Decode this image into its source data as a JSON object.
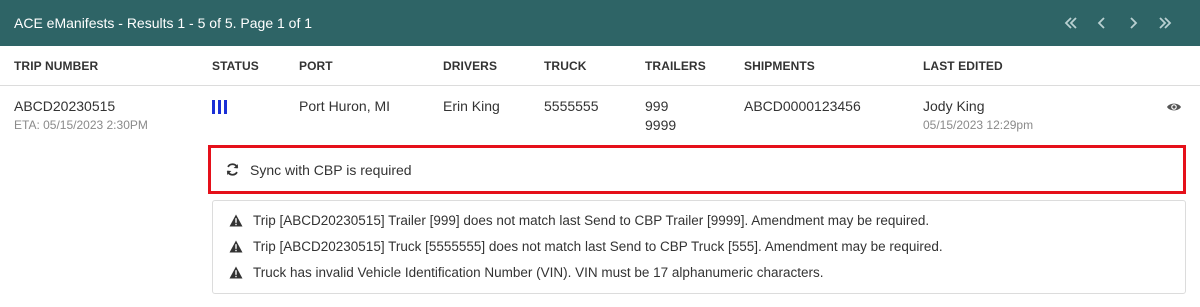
{
  "header": {
    "title": "ACE eManifests - Results 1 - 5 of 5. Page 1 of 1",
    "pager_first": "«",
    "pager_prev": "‹",
    "pager_next": "›",
    "pager_last": "»"
  },
  "columns": [
    "TRIP NUMBER",
    "STATUS",
    "PORT",
    "DRIVERS",
    "TRUCK",
    "TRAILERS",
    "SHIPMENTS",
    "LAST EDITED"
  ],
  "row": {
    "trip_number": "ABCD20230515",
    "eta": "ETA: 05/15/2023 2:30PM",
    "status_icon": "status-bars-icon",
    "port": "Port Huron, MI",
    "driver": "Erin King",
    "truck": "5555555",
    "trailers": [
      "999",
      "9999"
    ],
    "shipment": "ABCD0000123456",
    "last_edited_by": "Jody King",
    "last_edited_at": "05/15/2023 12:29pm",
    "view_icon": "eye-icon"
  },
  "sync_notice": {
    "icon": "sync-icon",
    "text": "Sync with CBP is required",
    "highlight_color": "#e5101a"
  },
  "warnings": [
    "Trip [ABCD20230515] Trailer [999] does not match last Send to CBP Trailer [9999]. Amendment may be required.",
    "Trip [ABCD20230515] Truck [5555555] does not match last Send to CBP Truck [555]. Amendment may be required.",
    "Truck has invalid Vehicle Identification Number (VIN). VIN must be 17 alphanumeric characters."
  ],
  "colors": {
    "header_bg": "#2e6466",
    "status_blue": "#1a2fd6"
  }
}
